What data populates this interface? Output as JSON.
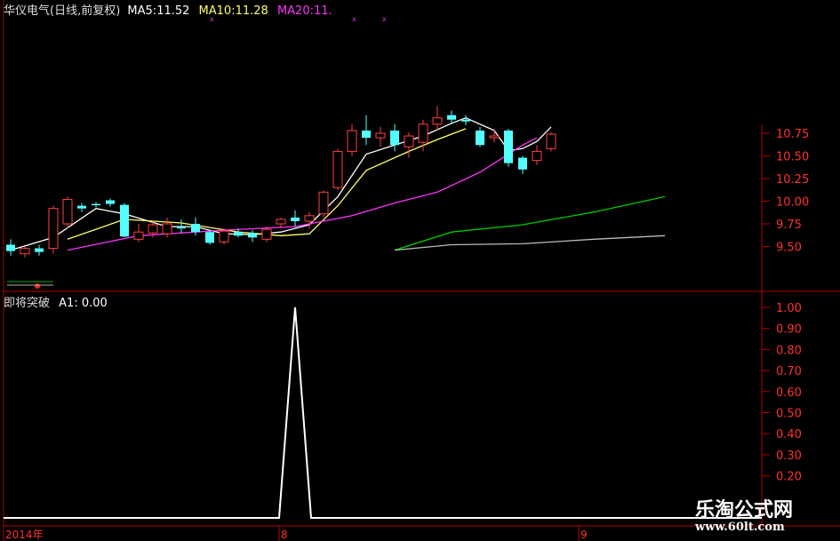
{
  "header": {
    "stock": "华仪电气(日线,前复权)",
    "ma5_label": "MA5:",
    "ma5_value": "11.52",
    "ma10_label": "MA10:",
    "ma10_value": "11.28",
    "ma20_label": "MA20:",
    "ma20_value": "11."
  },
  "indicator": {
    "name": "即将突破",
    "a1_label": "A1:",
    "a1_value": "0.00"
  },
  "watermark": {
    "cn": "乐淘公式网",
    "url": "www.60lt.com"
  },
  "colors": {
    "frame": "#b00000",
    "up": "#ff4040",
    "down": "#54ffff",
    "ma5": "#ffffff",
    "ma10": "#ffff66",
    "ma20": "#ff33ff",
    "ma_green": "#00cc00",
    "indicator_line": "#ffffff",
    "axis_text": "#ff3030"
  },
  "chart_data": [
    {
      "type": "candlestick",
      "title": "华仪电气(日线,前复权)",
      "y_ticks": [
        "10.75",
        "10.50",
        "10.25",
        "10.00",
        "9.75",
        "9.50"
      ],
      "x_ticks": [
        "2014年",
        "8",
        "9"
      ],
      "candles": [
        {
          "o": 9.52,
          "h": 9.58,
          "l": 9.4,
          "c": 9.45
        },
        {
          "o": 9.42,
          "h": 9.5,
          "l": 9.38,
          "c": 9.48
        },
        {
          "o": 9.48,
          "h": 9.52,
          "l": 9.4,
          "c": 9.44
        },
        {
          "o": 9.48,
          "h": 9.95,
          "l": 9.42,
          "c": 9.92
        },
        {
          "o": 9.75,
          "h": 10.05,
          "l": 9.7,
          "c": 10.02
        },
        {
          "o": 9.95,
          "h": 9.98,
          "l": 9.88,
          "c": 9.92
        },
        {
          "o": 9.97,
          "h": 9.99,
          "l": 9.93,
          "c": 9.96
        },
        {
          "o": 10.01,
          "h": 10.03,
          "l": 9.94,
          "c": 9.97
        },
        {
          "o": 9.96,
          "h": 9.98,
          "l": 9.6,
          "c": 9.61
        },
        {
          "o": 9.58,
          "h": 9.75,
          "l": 9.55,
          "c": 9.66
        },
        {
          "o": 9.65,
          "h": 9.78,
          "l": 9.6,
          "c": 9.74
        },
        {
          "o": 9.64,
          "h": 9.82,
          "l": 9.6,
          "c": 9.75
        },
        {
          "o": 9.72,
          "h": 9.8,
          "l": 9.65,
          "c": 9.7
        },
        {
          "o": 9.75,
          "h": 9.82,
          "l": 9.62,
          "c": 9.66
        },
        {
          "o": 9.66,
          "h": 9.68,
          "l": 9.52,
          "c": 9.54
        },
        {
          "o": 9.55,
          "h": 9.7,
          "l": 9.52,
          "c": 9.67
        },
        {
          "o": 9.66,
          "h": 9.7,
          "l": 9.6,
          "c": 9.62
        },
        {
          "o": 9.65,
          "h": 9.68,
          "l": 9.55,
          "c": 9.6
        },
        {
          "o": 9.58,
          "h": 9.72,
          "l": 9.55,
          "c": 9.69
        },
        {
          "o": 9.75,
          "h": 9.82,
          "l": 9.7,
          "c": 9.8
        },
        {
          "o": 9.82,
          "h": 9.9,
          "l": 9.72,
          "c": 9.78
        },
        {
          "o": 9.78,
          "h": 9.88,
          "l": 9.7,
          "c": 9.84
        },
        {
          "o": 9.86,
          "h": 10.12,
          "l": 9.82,
          "c": 10.1
        },
        {
          "o": 10.15,
          "h": 10.58,
          "l": 10.12,
          "c": 10.55
        },
        {
          "o": 10.55,
          "h": 10.85,
          "l": 10.5,
          "c": 10.78
        },
        {
          "o": 10.78,
          "h": 10.95,
          "l": 10.62,
          "c": 10.7
        },
        {
          "o": 10.7,
          "h": 10.82,
          "l": 10.6,
          "c": 10.75
        },
        {
          "o": 10.78,
          "h": 10.85,
          "l": 10.55,
          "c": 10.62
        },
        {
          "o": 10.6,
          "h": 10.76,
          "l": 10.48,
          "c": 10.72
        },
        {
          "o": 10.65,
          "h": 10.9,
          "l": 10.55,
          "c": 10.85
        },
        {
          "o": 10.85,
          "h": 11.05,
          "l": 10.78,
          "c": 10.92
        },
        {
          "o": 10.95,
          "h": 11.0,
          "l": 10.85,
          "c": 10.9
        },
        {
          "o": 10.9,
          "h": 10.95,
          "l": 10.84,
          "c": 10.88
        },
        {
          "o": 10.78,
          "h": 10.82,
          "l": 10.6,
          "c": 10.62
        },
        {
          "o": 10.7,
          "h": 10.8,
          "l": 10.65,
          "c": 10.72
        },
        {
          "o": 10.78,
          "h": 10.8,
          "l": 10.38,
          "c": 10.42
        },
        {
          "o": 10.48,
          "h": 10.5,
          "l": 10.3,
          "c": 10.35
        },
        {
          "o": 10.45,
          "h": 10.62,
          "l": 10.4,
          "c": 10.55
        },
        {
          "o": 10.58,
          "h": 10.76,
          "l": 10.55,
          "c": 10.74
        }
      ],
      "ma_lines": [
        {
          "name": "MA5",
          "points": [
            [
              0,
              9.46
            ],
            [
              3,
              9.6
            ],
            [
              6,
              9.92
            ],
            [
              8,
              9.86
            ],
            [
              11,
              9.72
            ],
            [
              13,
              9.72
            ],
            [
              15,
              9.64
            ],
            [
              17,
              9.63
            ],
            [
              19,
              9.66
            ],
            [
              21,
              9.74
            ],
            [
              23,
              10.05
            ],
            [
              25,
              10.52
            ],
            [
              27,
              10.62
            ],
            [
              29,
              10.72
            ],
            [
              31,
              10.86
            ],
            [
              32,
              10.92
            ],
            [
              34,
              10.78
            ],
            [
              35,
              10.56
            ],
            [
              36,
              10.58
            ],
            [
              37,
              10.66
            ],
            [
              38,
              10.82
            ]
          ]
        },
        {
          "name": "MA10",
          "points": [
            [
              4,
              9.58
            ],
            [
              8,
              9.8
            ],
            [
              12,
              9.76
            ],
            [
              16,
              9.66
            ],
            [
              19,
              9.62
            ],
            [
              21,
              9.64
            ],
            [
              23,
              9.95
            ],
            [
              25,
              10.34
            ],
            [
              28,
              10.55
            ],
            [
              30,
              10.68
            ],
            [
              32,
              10.8
            ]
          ]
        },
        {
          "name": "MA20",
          "points": [
            [
              4,
              9.46
            ],
            [
              9,
              9.62
            ],
            [
              15,
              9.68
            ],
            [
              20,
              9.72
            ],
            [
              24,
              9.84
            ],
            [
              27,
              9.98
            ],
            [
              30,
              10.1
            ],
            [
              33,
              10.32
            ],
            [
              36,
              10.62
            ],
            [
              37,
              10.7
            ]
          ]
        },
        {
          "name": "green",
          "points": [
            [
              27,
              9.46
            ],
            [
              31,
              9.66
            ],
            [
              36,
              9.74
            ],
            [
              41,
              9.88
            ],
            [
              46,
              10.05
            ]
          ]
        },
        {
          "name": "gray",
          "points": [
            [
              27,
              9.46
            ],
            [
              31,
              9.52
            ],
            [
              36,
              9.53
            ],
            [
              41,
              9.58
            ],
            [
              46,
              9.62
            ]
          ]
        }
      ]
    },
    {
      "type": "line",
      "title": "即将突破",
      "series": [
        {
          "name": "A1",
          "peak_index": 20,
          "peak_value": 1.0
        }
      ],
      "ylim": [
        0,
        1.05
      ],
      "y_ticks": [
        "1.00",
        "0.90",
        "0.80",
        "0.70",
        "0.60",
        "0.50",
        "0.40",
        "0.30",
        "0.20"
      ]
    }
  ]
}
